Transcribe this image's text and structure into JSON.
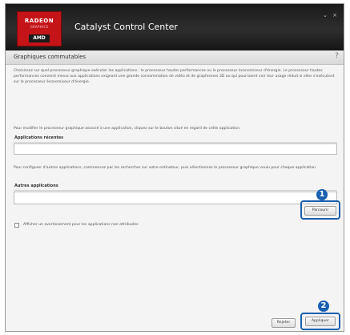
{
  "window": {
    "logo_line1": "RADEON",
    "logo_line2": "GRAPHICS",
    "logo_line3": "AMD",
    "title": "Catalyst Control Center",
    "minimize_glyph": "⌄",
    "close_glyph": "×"
  },
  "section": {
    "title": "Graphiques commutables",
    "help_glyph": "?"
  },
  "intro_text": "Choisissez sur quel processeur graphique exécuter les applications : le processeur hautes performances ou le processeur économiseur d'énergie. Le processeur hautes performances convient mieux aux applications exigeant une grande consommation de vidéo et de graphismes 3D ou qui pourraient voir leur usage réduit si elles s'exécutent sur le processeur économiseur d'énergie.",
  "recent": {
    "instruction": "Pour modifier le processeur graphique associé à une application, cliquez sur le bouton situé en regard de cette application.",
    "label": "Applications récentes"
  },
  "other": {
    "instruction": "Pour configurer d'autres applications, commencez par les rechercher sur votre ordinateur, puis sélectionnez le processeur graphique voulu pour chaque application.",
    "label": "Autres applications",
    "browse_button": "Parcourir"
  },
  "checkbox_label": "Afficher un avertissement pour les applications non attribuées",
  "footer": {
    "reset_button": "Rejeter",
    "apply_button": "Appliquer"
  },
  "annotations": {
    "badge1": "1",
    "badge2": "2"
  },
  "colors": {
    "accent": "#1a5fb0",
    "brand_red": "#c41418"
  }
}
